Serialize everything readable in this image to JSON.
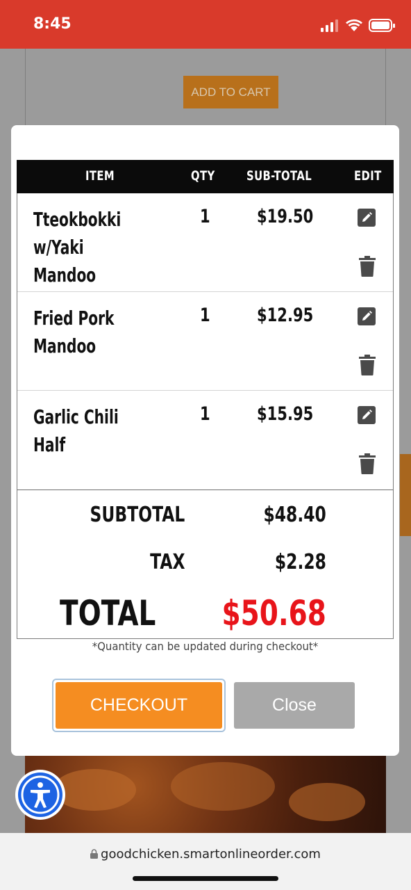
{
  "status_bar": {
    "time": "8:45"
  },
  "background": {
    "add_to_cart_label": "ADD TO CART"
  },
  "cart": {
    "headers": {
      "item": "ITEM",
      "qty": "QTY",
      "subtotal": "SUB-TOTAL",
      "edit": "EDIT"
    },
    "items": [
      {
        "name": "Tteokbokki w/Yaki Mandoo",
        "qty": "1",
        "subtotal": "$19.50"
      },
      {
        "name": "Fried Pork Mandoo",
        "qty": "1",
        "subtotal": "$12.95"
      },
      {
        "name": "Garlic Chili Half",
        "qty": "1",
        "subtotal": "$15.95"
      }
    ],
    "totals": {
      "subtotal_label": "SUBTOTAL",
      "subtotal_value": "$48.40",
      "tax_label": "TAX",
      "tax_value": "$2.28",
      "total_label": "TOTAL",
      "total_value": "$50.68"
    },
    "note": "*Quantity can be updated during checkout*",
    "checkout_label": "CHECKOUT",
    "close_label": "Close"
  },
  "browser": {
    "url": "goodchicken.smartonlineorder.com"
  },
  "colors": {
    "status_bar": "#d93a2b",
    "checkout": "#f58d21",
    "total": "#e8141a",
    "accessibility": "#1d63e3"
  }
}
